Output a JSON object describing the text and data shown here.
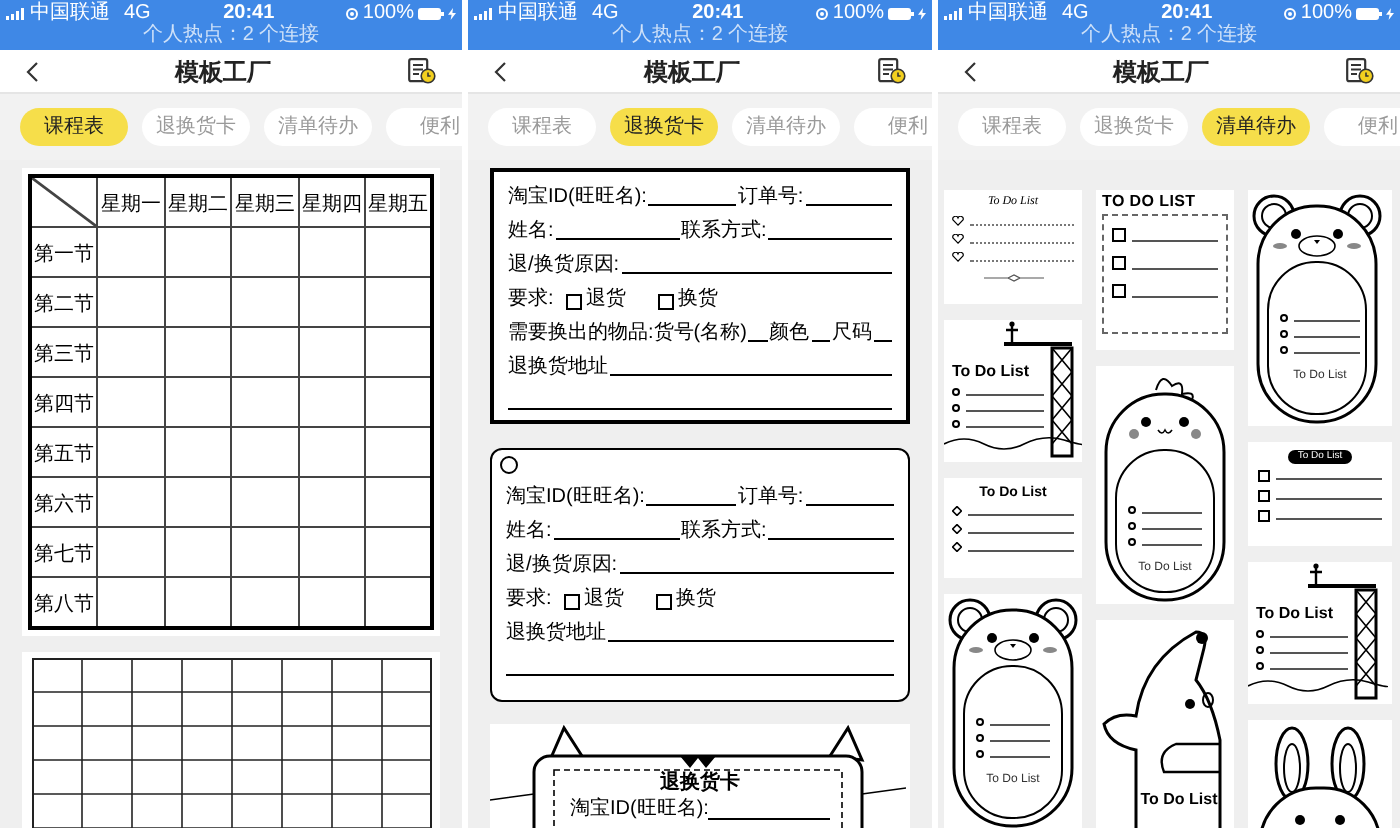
{
  "screens": [
    {
      "status_bar": {
        "carrier": "中国联通",
        "network": "4G",
        "time": "20:41",
        "battery": "100%",
        "hotspot": "个人热点：2 个连接"
      },
      "header": {
        "title": "模板工厂"
      },
      "tabs": [
        {
          "label": "课程表",
          "selected": true
        },
        {
          "label": "退换货卡",
          "selected": false
        },
        {
          "label": "清单待办",
          "selected": false
        },
        {
          "label": "便利",
          "selected": false
        }
      ],
      "kind": "list",
      "templates": [
        {
          "kind": "timetable",
          "columns": [
            "星期一",
            "星期二",
            "星期三",
            "星期四",
            "星期五"
          ],
          "rows": [
            "第一节",
            "第二节",
            "第三节",
            "第四节",
            "第五节",
            "第六节",
            "第七节",
            "第八节"
          ]
        },
        {
          "kind": "grid"
        }
      ]
    },
    {
      "status_bar": {
        "carrier": "中国联通",
        "network": "4G",
        "time": "20:41",
        "battery": "100%",
        "hotspot": "个人热点：2 个连接"
      },
      "header": {
        "title": "模板工厂"
      },
      "tabs": [
        {
          "label": "课程表",
          "selected": false
        },
        {
          "label": "退换货卡",
          "selected": true
        },
        {
          "label": "清单待办",
          "selected": false
        },
        {
          "label": "便利",
          "selected": false
        }
      ],
      "kind": "list",
      "templates": [
        {
          "kind": "plain_form",
          "rows": [
            {
              "kind": "line",
              "fields": [
                "淘宝ID(旺旺名):",
                "订单号:"
              ]
            },
            {
              "kind": "line",
              "fields": [
                "姓名:",
                "联系方式:"
              ]
            },
            {
              "kind": "line",
              "fields": [
                "退/换货原因:"
              ]
            },
            {
              "kind": "choice",
              "label": "要求:",
              "options": [
                {
                  "label": "退货",
                  "checked": false
                },
                {
                  "label": "换货",
                  "checked": false
                }
              ]
            },
            {
              "kind": "line",
              "fields": [
                "需要换出的物品:货号(名称)",
                "颜色",
                "尺码"
              ]
            },
            {
              "kind": "line",
              "fields": [
                "退换货地址"
              ]
            },
            {
              "kind": "blank"
            }
          ]
        },
        {
          "kind": "tag_form",
          "rows": [
            {
              "kind": "line",
              "fields": [
                "淘宝ID(旺旺名):",
                "订单号:"
              ]
            },
            {
              "kind": "line",
              "fields": [
                "姓名:",
                "联系方式:"
              ]
            },
            {
              "kind": "line",
              "fields": [
                "退/换货原因:"
              ]
            },
            {
              "kind": "choice",
              "label": "要求:",
              "options": [
                {
                  "label": "退货",
                  "checked": false
                },
                {
                  "label": "换货",
                  "checked": false
                }
              ]
            },
            {
              "kind": "line",
              "fields": [
                "退换货地址"
              ]
            },
            {
              "kind": "blank"
            }
          ]
        },
        {
          "kind": "cat_form",
          "title": "退换货卡",
          "rows": [
            {
              "kind": "line",
              "fields": [
                "淘宝ID(旺旺名):"
              ]
            }
          ]
        }
      ]
    },
    {
      "status_bar": {
        "carrier": "中国联通",
        "network": "4G",
        "time": "20:41",
        "battery": "100%",
        "hotspot": "个人热点：2 个连接"
      },
      "header": {
        "title": "模板工厂"
      },
      "tabs": [
        {
          "label": "课程表",
          "selected": false
        },
        {
          "label": "退换货卡",
          "selected": false
        },
        {
          "label": "清单待办",
          "selected": true
        },
        {
          "label": "便利",
          "selected": false
        }
      ],
      "kind": "masonry",
      "columns": [
        [
          {
            "kind": "ornate",
            "title": "To Do List"
          },
          {
            "kind": "tower",
            "title": "To Do List"
          },
          {
            "kind": "plain",
            "title": "To Do List"
          },
          {
            "kind": "bear",
            "title": "To Do List"
          }
        ],
        [
          {
            "kind": "checklist",
            "title": "TO DO LIST"
          },
          {
            "kind": "dino",
            "title": "To Do List"
          },
          {
            "kind": "dog",
            "title": "To Do List"
          }
        ],
        [
          {
            "kind": "bear",
            "title": "To Do List"
          },
          {
            "kind": "badge",
            "title": "To Do List"
          },
          {
            "kind": "tower",
            "title": "To Do List"
          },
          {
            "kind": "rabbit"
          }
        ]
      ]
    }
  ]
}
